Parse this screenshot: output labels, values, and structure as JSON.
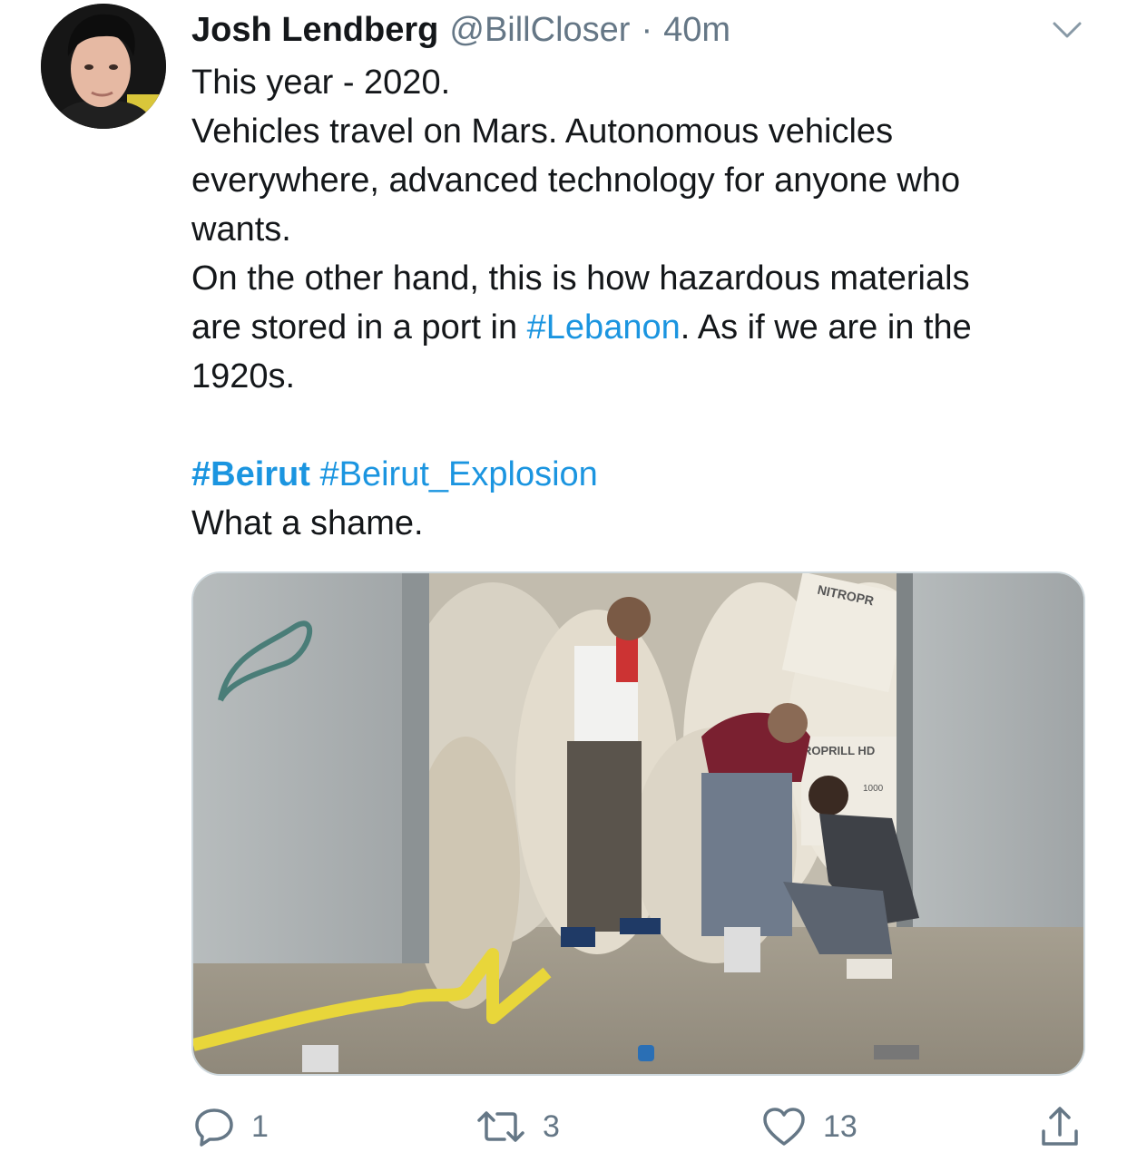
{
  "tweet": {
    "author": {
      "name": "Josh Lendberg",
      "handle": "@BillCloser"
    },
    "separator": "·",
    "time": "40m",
    "text_lines": [
      "This year - 2020.",
      "Vehicles travel on Mars. Autonomous vehicles",
      "everywhere, advanced technology for anyone who",
      "wants.",
      "On the other hand, this is how hazardous materials"
    ],
    "line6_before": "are stored in a port in ",
    "line6_hashtag": "#Lebanon",
    "line6_after": ". As if we are in the",
    "line7": "1920s.",
    "hashtag_beirut": "#Beirut",
    "hashtag_explosion": "#Beirut_Explosion",
    "closing_line": "What a shame.",
    "media_text": {
      "bag_label_top": "NITROPR",
      "bag_label_mid": "ROPRILL HD",
      "bag_label_num": "1000"
    },
    "counts": {
      "replies": "1",
      "retweets": "3",
      "likes": "13"
    }
  },
  "icons": {
    "caret": "chevron-down-icon",
    "reply": "reply-icon",
    "retweet": "retweet-icon",
    "like": "heart-icon",
    "share": "share-icon"
  },
  "colors": {
    "text": "#14171a",
    "secondary": "#657786",
    "link": "#1b95e0",
    "border": "#cfd9de"
  }
}
